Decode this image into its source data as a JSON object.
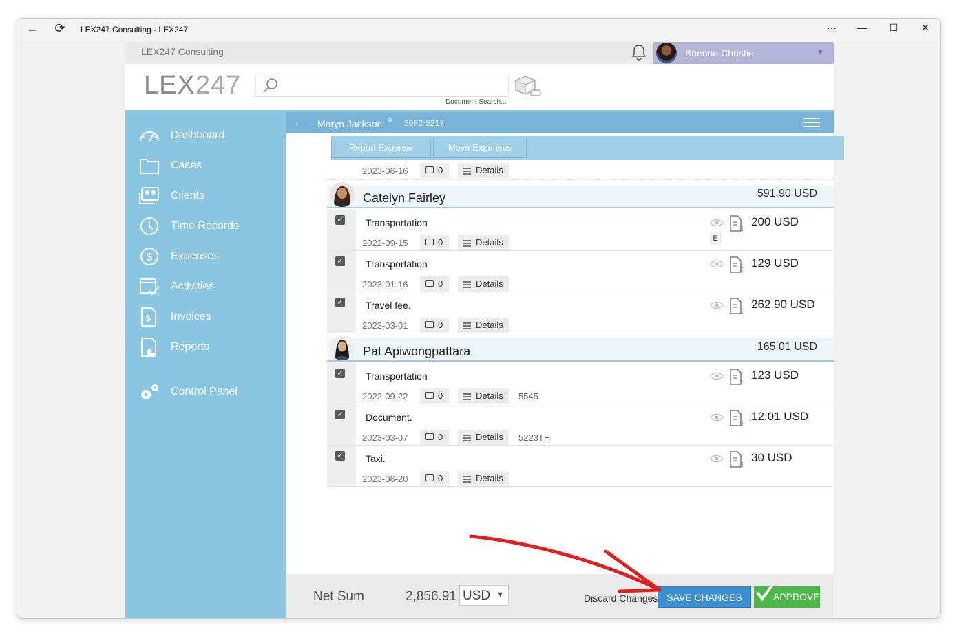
{
  "window": {
    "title": "LEX247 Consulting - LEX247"
  },
  "topbar": {
    "firm_name": "LEX247 Consulting",
    "user_name": "Brienne Christie"
  },
  "header": {
    "logo_bold": "LEX",
    "logo_thin": "247",
    "search_caption": "Document Search..."
  },
  "sidebar": {
    "items": [
      {
        "label": "Dashboard",
        "icon": "dashboard-icon"
      },
      {
        "label": "Cases",
        "icon": "folder-icon"
      },
      {
        "label": "Clients",
        "icon": "clients-icon"
      },
      {
        "label": "Time Records",
        "icon": "clock-icon"
      },
      {
        "label": "Expenses",
        "icon": "dollar-icon"
      },
      {
        "label": "Activities",
        "icon": "calendar-icon"
      },
      {
        "label": "Invoices",
        "icon": "invoice-icon"
      },
      {
        "label": "Reports",
        "icon": "reports-icon"
      },
      {
        "label": "Control Panel",
        "icon": "gears-icon"
      }
    ]
  },
  "case": {
    "name": "Maryn Jackson",
    "number": "20F2-5217"
  },
  "popup": {
    "report_expense": "Report Expense",
    "move_expenses": "Move Expenses"
  },
  "top_row": {
    "date": "2023-06-16",
    "comments": "0",
    "details": "Details"
  },
  "groups": [
    {
      "name": "Catelyn Fairley",
      "sum": "591.90 USD",
      "rows": [
        {
          "desc": "Transportation",
          "date": "2022-09-15",
          "comments": "0",
          "details": "Details",
          "extra": "",
          "amount": "200 USD",
          "tag": "E"
        },
        {
          "desc": "Transportation",
          "date": "2023-01-16",
          "comments": "0",
          "details": "Details",
          "extra": "",
          "amount": "129 USD",
          "tag": ""
        },
        {
          "desc": "Travel fee.",
          "date": "2023-03-01",
          "comments": "0",
          "details": "Details",
          "extra": "",
          "amount": "262.90 USD",
          "tag": ""
        }
      ]
    },
    {
      "name": "Pat Apiwongpattara",
      "sum": "165.01 USD",
      "rows": [
        {
          "desc": "Transportation",
          "date": "2022-09-22",
          "comments": "0",
          "details": "Details",
          "extra": "5545",
          "amount": "123 USD",
          "tag": ""
        },
        {
          "desc": "Document.",
          "date": "2023-03-07",
          "comments": "0",
          "details": "Details",
          "extra": "5223TH",
          "amount": "12.01 USD",
          "tag": ""
        },
        {
          "desc": "Taxi.",
          "date": "2023-06-20",
          "comments": "0",
          "details": "Details",
          "extra": "",
          "amount": "30 USD",
          "tag": ""
        }
      ]
    }
  ],
  "footer": {
    "net_label": "Net Sum",
    "net_value": "2,856.91",
    "currency": "USD",
    "discard": "Discard Changes",
    "save": "SAVE CHANGES",
    "approve": "APPROVE"
  },
  "colors": {
    "sidebar": "#8ac6e2",
    "bluebar": "#7ab3d8",
    "save": "#3b8fd1",
    "approve": "#4db848",
    "annotation_arrow": "#e02020"
  }
}
